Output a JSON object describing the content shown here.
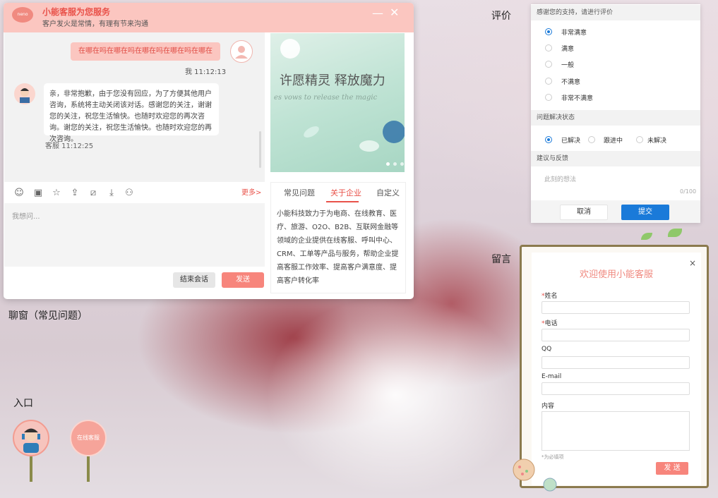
{
  "labels": {
    "chat": "聊窗（常见问题）",
    "entry": "入口",
    "rating": "评价",
    "message": "留言"
  },
  "chat": {
    "logo": "neno",
    "title": "小能客服为您服务",
    "subtitle": "客户发火是常情，有理有节来沟通",
    "minimize_icon": "minimize-icon",
    "close_icon": "close-icon",
    "user_message": "在哪在吗在哪在吗在哪在吗在哪在吗在哪在",
    "user_time": "我  11:12:13",
    "agent_message": "亲，非常抱歉，由于您没有回应，为了方便其他用户咨询，系统将主动关闭该对话。感谢您的关注，谢谢您的关注，祝您生活愉快。也随时欢迎您的再次咨询。谢您的关注，祝您生活愉快。也随时欢迎您的再次咨询。",
    "agent_time": "客服  11:12:25",
    "toolbar": [
      "emoji-icon",
      "image-icon",
      "star-icon",
      "upload-icon",
      "crop-icon",
      "download-icon",
      "transfer-user-icon"
    ],
    "more": "更多>",
    "input_placeholder": "我想问...",
    "end_button": "结束会话",
    "send_button": "发送",
    "banner_title": "许愿精灵  释放魔力",
    "banner_sub": "es vows to release the magic",
    "tabs": [
      "常见问题",
      "关于企业",
      "自定义"
    ],
    "active_tab": 1,
    "info_text": "小能科技致力于为电商、在线教育、医疗、旅游、O2O、B2B、互联网金融等领域的企业提供在线客服、呼叫中心、CRM、工单等产品与服务，帮助企业提高客服工作效率、提高客户满意度、提高客户转化率"
  },
  "entry": {
    "online_label": "在线客服"
  },
  "rating": {
    "header": "感谢您的支持，请进行评价",
    "options": [
      "非常满意",
      "满意",
      "一般",
      "不满意",
      "非常不满意"
    ],
    "selected": 0,
    "resolve_header": "问题解决状态",
    "resolve_options": [
      "已解决",
      "跟进中",
      "未解决"
    ],
    "resolve_selected": 0,
    "feedback_header": "建议与反馈",
    "feedback_placeholder": "此刻的想法",
    "feedback_count": "0/100",
    "cancel": "取消",
    "submit": "提交"
  },
  "message_form": {
    "title": "欢迎使用小能客服",
    "close": "×",
    "fields": [
      {
        "label": "姓名",
        "required": true
      },
      {
        "label": "电话",
        "required": true
      },
      {
        "label": "QQ",
        "required": false
      },
      {
        "label": "E-mail",
        "required": false
      },
      {
        "label": "内容",
        "required": false
      }
    ],
    "hint": "*为必填项",
    "send": "发 送"
  },
  "colors": {
    "accent": "#e9524a",
    "pink": "#fbc6c0",
    "blue": "#1a7ad9"
  }
}
